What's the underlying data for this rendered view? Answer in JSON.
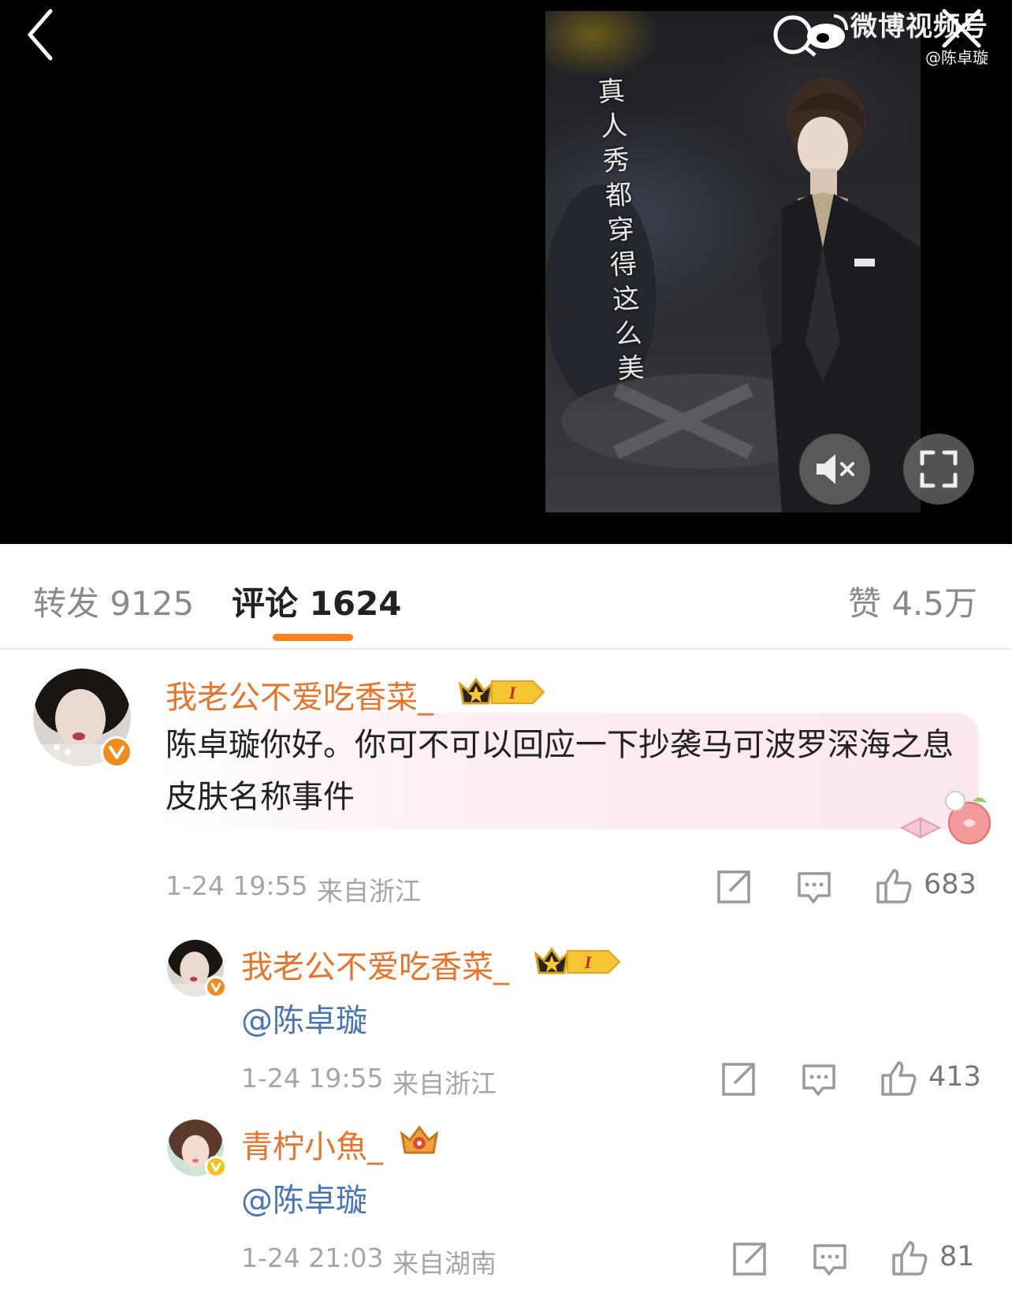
{
  "video": {
    "caption": "真人秀都穿得这么美",
    "watermark_title": "微博视频号",
    "watermark_handle": "@陈卓璇"
  },
  "tabs": {
    "repost": "转发 9125",
    "comments": "评论 1624",
    "likes": "赞 4.5万"
  },
  "comments": [
    {
      "username": "我老公不爱吃香菜_",
      "vip_level": "I",
      "text": "陈卓璇你好。你可不可以回应一下抄袭马可波罗深海之息皮肤名称事件",
      "date": "1-24 19:55",
      "location": "来自浙江",
      "likes": "683"
    },
    {
      "username": "我老公不爱吃香菜_",
      "vip_level": "I",
      "text": "@陈卓璇",
      "date": "1-24 19:55",
      "location": "来自浙江",
      "likes": "413"
    },
    {
      "username": "青柠小魚_",
      "text": "@陈卓璇",
      "date": "1-24 21:03",
      "location": "来自湖南",
      "likes": "81"
    }
  ],
  "colors": {
    "username": "#e8742b",
    "mention": "#4a74b8",
    "tab_indicator": "#ff7f1a",
    "verified_orange": "#f08b1c",
    "verified_gold": "#f4c21a"
  }
}
